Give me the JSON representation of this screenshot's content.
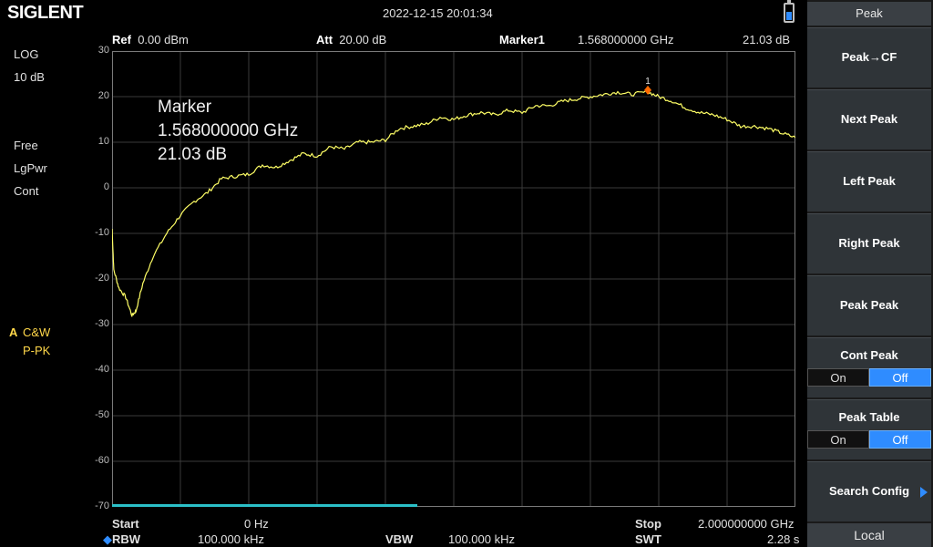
{
  "header": {
    "brand": "SIGLENT",
    "datetime": "2022-12-15   20:01:34",
    "ref_label": "Ref",
    "ref_value": "0.00 dBm",
    "att_label": "Att",
    "att_value": "20.00 dB",
    "marker_label": "Marker1",
    "marker_freq": "1.568000000 GHz",
    "marker_amp": "21.03 dB"
  },
  "left_panel": {
    "scale_type": "LOG",
    "scale_div": "10 dB",
    "trigger": "Free",
    "detector": "LgPwr",
    "sweep": "Cont",
    "trace_id": "A",
    "trace_mode": "C&W",
    "trace_det": "P-PK"
  },
  "y_axis": {
    "ticks": [
      "30",
      "20",
      "10",
      "0",
      "-10",
      "-20",
      "-30",
      "-40",
      "-50",
      "-60",
      "-70"
    ]
  },
  "marker_readout": {
    "title": "Marker",
    "freq": "1.568000000 GHz",
    "amp": "21.03 dB",
    "marker_number": "1"
  },
  "bottom": {
    "start_label": "Start",
    "start_value": "0 Hz",
    "stop_label": "Stop",
    "stop_value": "2.000000000 GHz",
    "rbw_label": "RBW",
    "rbw_value": "100.000 kHz",
    "vbw_label": "VBW",
    "vbw_value": "100.000 kHz",
    "swt_label": "SWT",
    "swt_value": "2.28 s"
  },
  "menu": {
    "title": "Peak",
    "items": [
      {
        "label": "Peak→CF"
      },
      {
        "label": "Next Peak"
      },
      {
        "label": "Left Peak"
      },
      {
        "label": "Right Peak"
      },
      {
        "label": "Peak Peak"
      },
      {
        "label": "Cont Peak",
        "toggle": {
          "on": "On",
          "off": "Off",
          "selected": "Off"
        }
      },
      {
        "label": "Peak Table",
        "toggle": {
          "on": "On",
          "off": "Off",
          "selected": "Off"
        }
      },
      {
        "label": "Search Config"
      }
    ],
    "local": "Local"
  },
  "colors": {
    "trace": "#ffff66",
    "grid": "#3a3a3a",
    "marker": "#ff6a00",
    "accent": "#2f8cff"
  },
  "chart_data": {
    "type": "line",
    "x_unit": "GHz",
    "y_unit": "dB",
    "xlim": [
      0,
      2.0
    ],
    "ylim": [
      -70,
      30
    ],
    "grid": true,
    "series": [
      {
        "x": [
          0,
          0.005,
          0.02,
          0.04,
          0.058,
          0.07,
          0.09,
          0.12,
          0.16,
          0.2,
          0.24,
          0.28,
          0.32,
          0.36,
          0.4,
          0.44,
          0.48,
          0.52,
          0.56,
          0.6,
          0.64,
          0.68,
          0.72,
          0.76,
          0.8,
          0.84,
          0.88,
          0.92,
          0.96,
          1.0,
          1.04,
          1.08,
          1.12,
          1.16,
          1.2,
          1.24,
          1.28,
          1.32,
          1.36,
          1.4,
          1.44,
          1.48,
          1.52,
          1.568,
          1.6,
          1.64,
          1.68,
          1.72,
          1.76,
          1.8,
          1.84,
          1.88,
          1.92,
          1.96,
          2.0
        ],
        "y": [
          -9,
          -18,
          -22,
          -24,
          -28,
          -27,
          -21,
          -15,
          -10,
          -6,
          -3,
          -1,
          2,
          2.5,
          3,
          5,
          4.5,
          6,
          7.5,
          7,
          9,
          8.5,
          10,
          10,
          10.5,
          13,
          13.5,
          14,
          15.5,
          15,
          16,
          16.5,
          16,
          17,
          16.5,
          18,
          18,
          19,
          19.5,
          20,
          20.5,
          21,
          20.5,
          21.03,
          20,
          19,
          17.5,
          16.5,
          16,
          15,
          13.5,
          13.5,
          13,
          12,
          11
        ]
      }
    ]
  }
}
